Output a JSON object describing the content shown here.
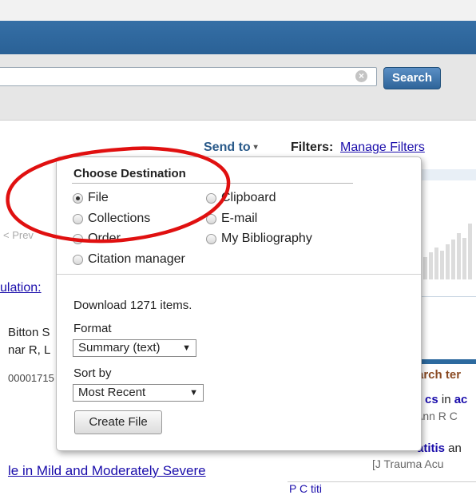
{
  "search": {
    "button_label": "Search",
    "clear_glyph": "×"
  },
  "toolbar": {
    "send_to_label": "Send to",
    "send_to_caret": "▾",
    "filters_label": "Filters:",
    "manage_filters_link": "Manage Filters"
  },
  "popup": {
    "title": "Choose Destination",
    "options": [
      {
        "label": "File",
        "checked": true
      },
      {
        "label": "Clipboard",
        "checked": false
      },
      {
        "label": "Collections",
        "checked": false
      },
      {
        "label": "E-mail",
        "checked": false
      },
      {
        "label": "Order",
        "checked": false
      },
      {
        "label": "My Bibliography",
        "checked": false
      },
      {
        "label": "Citation manager",
        "checked": false
      }
    ],
    "download_text": "Download 1271 items.",
    "format_label": "Format",
    "format_selected": "Summary (text)",
    "sortby_label": "Sort by",
    "sortby_selected": "Most Recent",
    "create_button": "Create File"
  },
  "background": {
    "link_1": "ulation:",
    "text_1": "Bitton S",
    "text_2": "nar R, L",
    "text_3": "00001715",
    "link_2": "le in Mild and Moderately Severe",
    "prev_text": "< Prev"
  },
  "sidebar": {
    "search_terms_title": "arch ter",
    "term_1_a": "cs",
    "term_1_b": " in ",
    "term_1_c": "ac",
    "term_1_source": "Ann R C",
    "term_2_a": "atitis",
    "term_2_b": " an",
    "term_2_source": "[J Trauma Acu",
    "bottom_text": "P  C                    titi"
  },
  "colors": {
    "header": "#2d6a9f",
    "link": "#1a0dab",
    "annotation": "#e01010"
  }
}
